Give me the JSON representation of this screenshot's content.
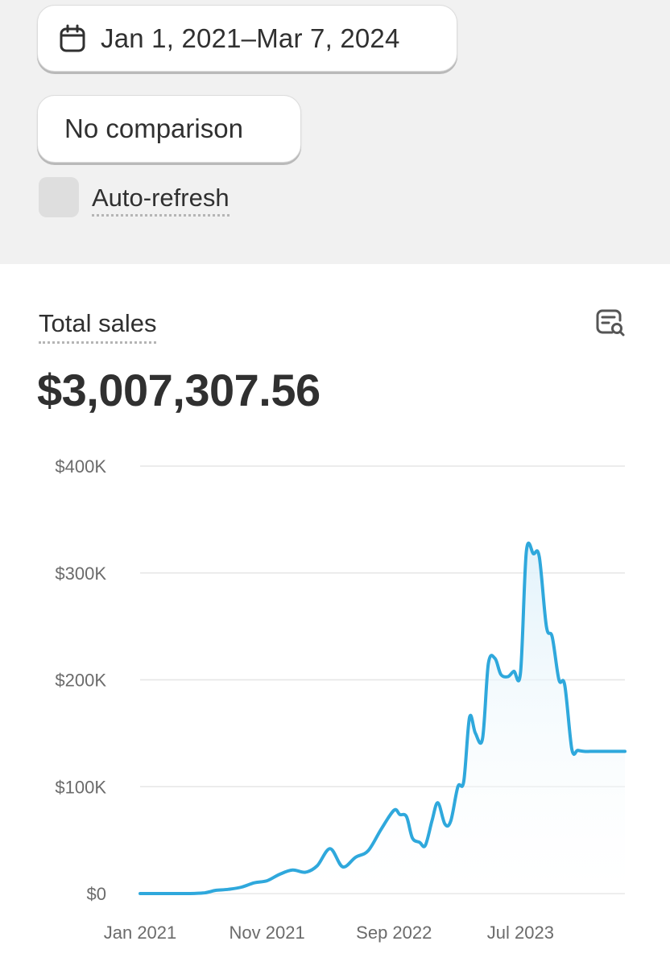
{
  "filters": {
    "date_range_label": "Jan 1, 2021–Mar 7, 2024",
    "comparison_label": "No comparison",
    "auto_refresh_label": "Auto-refresh",
    "auto_refresh_checked": false
  },
  "metric": {
    "title": "Total sales",
    "value": "$3,007,307.56"
  },
  "colors": {
    "line": "#2fa8dc",
    "area_top": "#e3f3fb",
    "grid": "#e6e6e6",
    "axis_text": "#6b6b6b"
  },
  "chart_data": {
    "type": "area",
    "title": "",
    "xlabel": "",
    "ylabel": "",
    "ylim": [
      0,
      400000
    ],
    "y_ticks": [
      0,
      100000,
      200000,
      300000,
      400000
    ],
    "y_tick_labels": [
      "$0",
      "$100K",
      "$200K",
      "$300K",
      "$400K"
    ],
    "x_ticks": [
      "2021-01",
      "2021-11",
      "2022-09",
      "2023-07"
    ],
    "x_tick_labels": [
      "Jan 2021",
      "Nov 2021",
      "Sep 2022",
      "Jul 2023"
    ],
    "grid": true,
    "series": [
      {
        "x": [
          "2021-01-01",
          "2021-02-01",
          "2021-03-01",
          "2021-04-01",
          "2021-05-01",
          "2021-06-01",
          "2021-06-15",
          "2021-07-01",
          "2021-08-01",
          "2021-09-01",
          "2021-10-01",
          "2021-11-01",
          "2021-12-01",
          "2022-01-01",
          "2022-02-01",
          "2022-03-01",
          "2022-04-01",
          "2022-05-01",
          "2022-06-01",
          "2022-07-01",
          "2022-08-01",
          "2022-09-01",
          "2022-09-15",
          "2022-10-01",
          "2022-10-15",
          "2022-11-01",
          "2022-11-15",
          "2022-12-01",
          "2022-12-15",
          "2023-01-01",
          "2023-01-15",
          "2023-02-01",
          "2023-02-15",
          "2023-03-01",
          "2023-03-15",
          "2023-04-01",
          "2023-04-15",
          "2023-05-01",
          "2023-05-15",
          "2023-06-01",
          "2023-06-15",
          "2023-07-01",
          "2023-07-15",
          "2023-08-01",
          "2023-08-15",
          "2023-09-01",
          "2023-09-15",
          "2023-10-01",
          "2023-10-15",
          "2023-11-01",
          "2023-11-15",
          "2023-12-01",
          "2023-12-15",
          "2024-01-01",
          "2024-01-15",
          "2024-02-01",
          "2024-02-15",
          "2024-03-07"
        ],
        "y": [
          0,
          0,
          0,
          0,
          0,
          500,
          1500,
          3000,
          4000,
          6000,
          10000,
          12000,
          18000,
          22000,
          20000,
          26000,
          42000,
          25000,
          34000,
          40000,
          60000,
          78000,
          74000,
          72000,
          52000,
          48000,
          45000,
          68000,
          85000,
          65000,
          68000,
          100000,
          105000,
          165000,
          150000,
          145000,
          215000,
          220000,
          205000,
          203000,
          208000,
          207000,
          320000,
          318000,
          315000,
          250000,
          240000,
          200000,
          195000,
          135000,
          134000,
          133000,
          133000,
          133000,
          133000,
          133000,
          133000,
          133000
        ]
      }
    ]
  }
}
